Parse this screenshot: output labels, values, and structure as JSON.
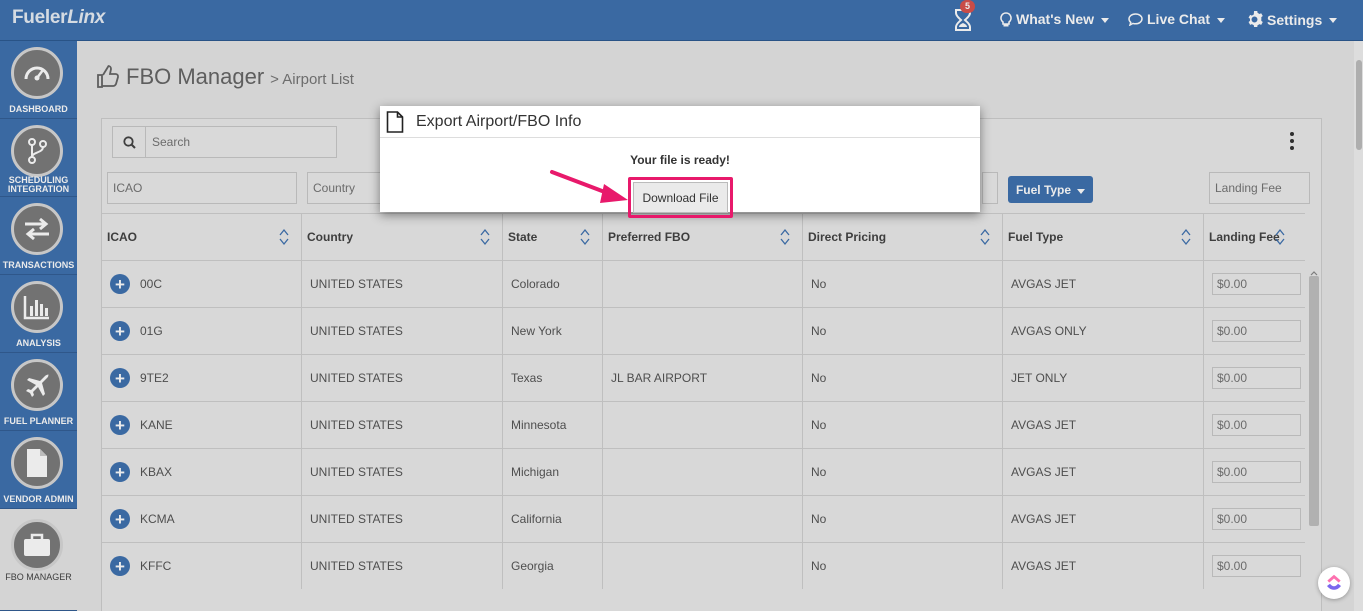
{
  "app": {
    "brand_part1": "Fueler",
    "brand_part2": "Linx"
  },
  "topnav": {
    "notification_count": "5",
    "whats_new": "What's New",
    "live_chat": "Live Chat",
    "settings": "Settings"
  },
  "sidebar": {
    "items": [
      {
        "label": "DASHBOARD",
        "icon": "gauge-icon"
      },
      {
        "label": "SCHEDULING",
        "label2": "INTEGRATION",
        "icon": "branch-icon"
      },
      {
        "label": "TRANSACTIONS",
        "icon": "swap-arrows-icon"
      },
      {
        "label": "ANALYSIS",
        "icon": "bar-chart-icon"
      },
      {
        "label": "FUEL PLANNER",
        "icon": "airplane-icon"
      },
      {
        "label": "VENDOR ADMIN",
        "icon": "document-icon"
      },
      {
        "label": "FBO MANAGER",
        "icon": "briefcase-icon"
      }
    ]
  },
  "page": {
    "title": "FBO Manager",
    "subtitle": "> Airport List"
  },
  "toolbar": {
    "search_placeholder": "Search"
  },
  "filters": {
    "icao_placeholder": "ICAO",
    "country_placeholder": "Country",
    "fuel_type_button": "Fuel Type",
    "landing_fee_placeholder": "Landing Fee"
  },
  "table": {
    "headers": [
      "ICAO",
      "Country",
      "State",
      "Preferred FBO",
      "Direct Pricing",
      "Fuel Type",
      "Landing Fee"
    ],
    "rows": [
      {
        "icao": "00C",
        "country": "UNITED STATES",
        "state": "Colorado",
        "fbo": "",
        "direct": "No",
        "fuel": "AVGAS JET",
        "fee": "$0.00"
      },
      {
        "icao": "01G",
        "country": "UNITED STATES",
        "state": "New York",
        "fbo": "",
        "direct": "No",
        "fuel": "AVGAS ONLY",
        "fee": "$0.00"
      },
      {
        "icao": "9TE2",
        "country": "UNITED STATES",
        "state": "Texas",
        "fbo": "JL BAR AIRPORT",
        "direct": "No",
        "fuel": "JET ONLY",
        "fee": "$0.00"
      },
      {
        "icao": "KANE",
        "country": "UNITED STATES",
        "state": "Minnesota",
        "fbo": "",
        "direct": "No",
        "fuel": "AVGAS JET",
        "fee": "$0.00"
      },
      {
        "icao": "KBAX",
        "country": "UNITED STATES",
        "state": "Michigan",
        "fbo": "",
        "direct": "No",
        "fuel": "AVGAS JET",
        "fee": "$0.00"
      },
      {
        "icao": "KCMA",
        "country": "UNITED STATES",
        "state": "California",
        "fbo": "",
        "direct": "No",
        "fuel": "AVGAS JET",
        "fee": "$0.00"
      },
      {
        "icao": "KFFC",
        "country": "UNITED STATES",
        "state": "Georgia",
        "fbo": "",
        "direct": "No",
        "fuel": "AVGAS JET",
        "fee": "$0.00"
      }
    ]
  },
  "modal": {
    "title": "Export Airport/FBO Info",
    "message": "Your file is ready!",
    "download_label": "Download File"
  },
  "colors": {
    "brand_blue": "#3f72b0",
    "highlight_pink": "#e8196b",
    "badge_red": "#d9534f"
  }
}
